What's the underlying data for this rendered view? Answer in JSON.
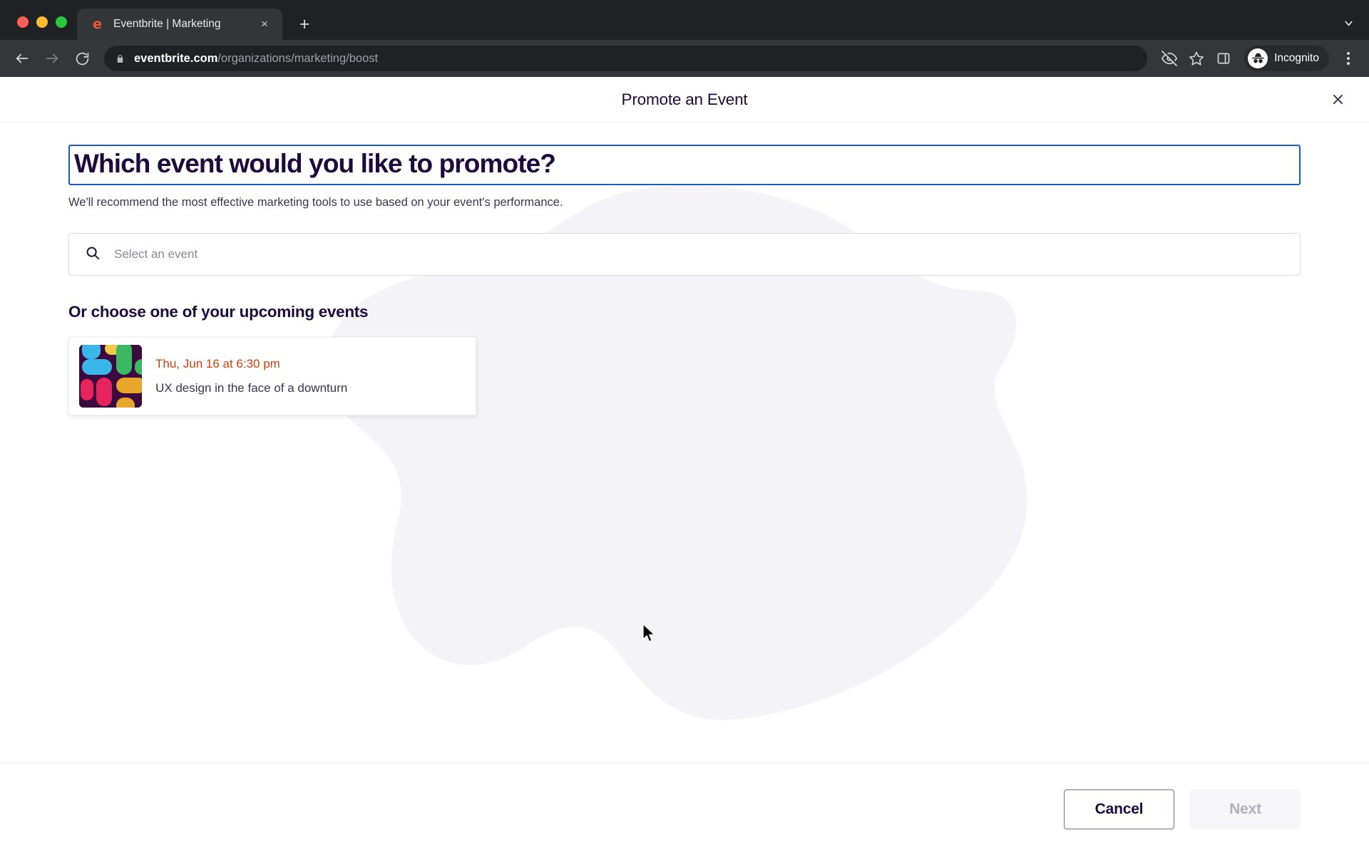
{
  "browser": {
    "window_controls": [
      "close",
      "minimize",
      "maximize"
    ],
    "tab": {
      "title": "Eventbrite | Marketing",
      "favicon_letter": "e",
      "favicon_name": "eventbrite-favicon",
      "close_label": "×"
    },
    "new_tab_label": "+",
    "tab_search_icon": "chevron-down-icon",
    "nav": {
      "back": "back-arrow-icon",
      "forward": "forward-arrow-icon",
      "reload": "reload-icon"
    },
    "omnibox": {
      "lock_icon": "lock-icon",
      "host": "eventbrite.com",
      "path": "/organizations/marketing/boost"
    },
    "toolbar_icons": [
      "eye-off-icon",
      "star-icon",
      "side-panel-icon"
    ],
    "profile": {
      "label": "Incognito",
      "avatar_icon": "incognito-icon"
    },
    "menu_icon": "kebab-menu-icon"
  },
  "modal": {
    "title": "Promote an Event",
    "close_label": "×"
  },
  "content": {
    "heading": "Which event would you like to promote?",
    "subheading": "We'll recommend the most effective marketing tools to use based on your event's performance.",
    "search": {
      "placeholder": "Select an event",
      "value": "",
      "icon": "search-icon"
    },
    "section_title": "Or choose one of your upcoming events",
    "events": [
      {
        "date": "Thu, Jun 16 at 6:30 pm",
        "title": "UX design in the face of a downturn",
        "thumbnail_name": "event-thumbnail"
      }
    ]
  },
  "footer": {
    "cancel_label": "Cancel",
    "next_label": "Next",
    "next_disabled": true
  },
  "colors": {
    "brand_orange": "#f05537",
    "date_red": "#d1410c",
    "ink": "#1e0a3c",
    "focus_blue": "#1a5bbd",
    "chrome_dark": "#202124",
    "toolbar_dark": "#35363a"
  }
}
